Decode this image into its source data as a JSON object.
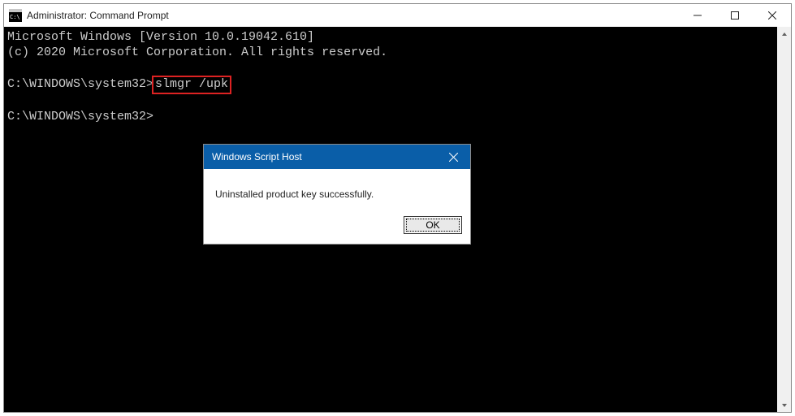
{
  "titlebar": {
    "title": "Administrator: Command Prompt"
  },
  "console": {
    "line1": "Microsoft Windows [Version 10.0.19042.610]",
    "line2": "(c) 2020 Microsoft Corporation. All rights reserved.",
    "prompt1_path": "C:\\WINDOWS\\system32>",
    "prompt1_cmd": "slmgr /upk",
    "prompt2_path": "C:\\WINDOWS\\system32>"
  },
  "dialog": {
    "title": "Windows Script Host",
    "message": "Uninstalled product key successfully.",
    "ok_label": "OK"
  }
}
